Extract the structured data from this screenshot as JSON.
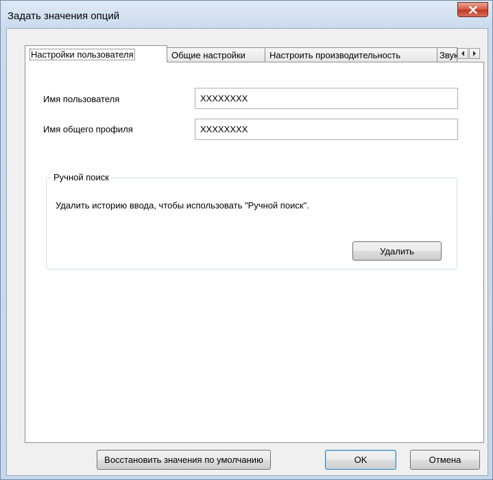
{
  "window": {
    "title": "Задать значения опций"
  },
  "tabs": [
    {
      "label": "Настройки пользователя"
    },
    {
      "label": "Общие настройки"
    },
    {
      "label": "Настроить производительность"
    },
    {
      "label": "Звук"
    }
  ],
  "user_settings": {
    "username_label": "Имя пользователя",
    "username_value": "XXXXXXXX",
    "profile_label": "Имя общего профиля",
    "profile_value": "XXXXXXXX",
    "manual_search": {
      "legend": "Ручной поиск",
      "description": "Удалить историю ввода, чтобы использовать \"Ручной поиск\".",
      "delete_label": "Удалить"
    }
  },
  "footer": {
    "restore_label": "Восстановить значения по умолчанию",
    "ok_label": "OK",
    "cancel_label": "Отмена"
  },
  "colors": {
    "close_button": "#c8452d",
    "default_button_border": "#3c7fb1"
  }
}
